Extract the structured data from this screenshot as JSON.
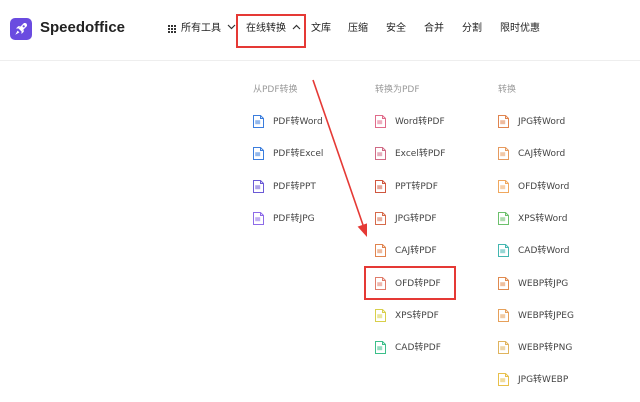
{
  "header": {
    "brand": "Speedoffice",
    "nav": [
      {
        "label": "所有工具"
      },
      {
        "label": "在线转换"
      },
      {
        "label": "文库"
      },
      {
        "label": "压缩"
      },
      {
        "label": "安全"
      },
      {
        "label": "合并"
      },
      {
        "label": "分割"
      },
      {
        "label": "限时优惠"
      }
    ]
  },
  "menu": {
    "columns": [
      {
        "heading": "从PDF转换",
        "items": [
          {
            "label": "PDF转Word",
            "color": "#3b7ddd"
          },
          {
            "label": "PDF转Excel",
            "color": "#3b7ddd"
          },
          {
            "label": "PDF转PPT",
            "color": "#6b5ad6"
          },
          {
            "label": "PDF转JPG",
            "color": "#8d6be8"
          }
        ]
      },
      {
        "heading": "转换为PDF",
        "items": [
          {
            "label": "Word转PDF",
            "color": "#e06b8a"
          },
          {
            "label": "Excel转PDF",
            "color": "#d06a85"
          },
          {
            "label": "PPT转PDF",
            "color": "#d0573f"
          },
          {
            "label": "JPG转PDF",
            "color": "#d66a4a"
          },
          {
            "label": "CAJ转PDF",
            "color": "#e0844f"
          },
          {
            "label": "OFD转PDF",
            "color": "#e07c6a"
          },
          {
            "label": "XPS转PDF",
            "color": "#d8cf4a"
          },
          {
            "label": "CAD转PDF",
            "color": "#3cbf8a"
          }
        ]
      },
      {
        "heading": "转换",
        "items": [
          {
            "label": "JPG转Word",
            "color": "#e0844f"
          },
          {
            "label": "CAJ转Word",
            "color": "#e69a5e"
          },
          {
            "label": "OFD转Word",
            "color": "#f0a85e"
          },
          {
            "label": "XPS转Word",
            "color": "#6cc06c"
          },
          {
            "label": "CAD转Word",
            "color": "#43b6b0"
          },
          {
            "label": "WEBP转JPG",
            "color": "#e08a4f"
          },
          {
            "label": "WEBP转JPEG",
            "color": "#e6a05a"
          },
          {
            "label": "WEBP转PNG",
            "color": "#e0b45e"
          },
          {
            "label": "JPG转WEBP",
            "color": "#e8c04a"
          }
        ]
      }
    ]
  },
  "annotation": {
    "color": "#e53935"
  }
}
